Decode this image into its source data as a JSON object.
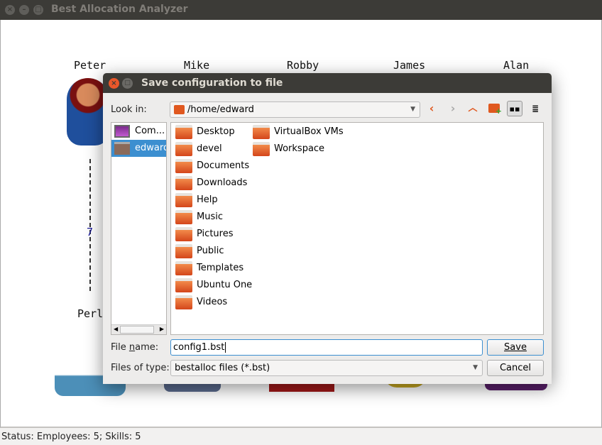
{
  "window": {
    "title": "Best Allocation Analyzer"
  },
  "canvas": {
    "employees": [
      "Peter",
      "Mike",
      "Robby",
      "James",
      "Alan"
    ],
    "skills": [
      "Perl"
    ],
    "link_label": "7"
  },
  "status": "Status:  Employees: 5;  Skills: 5",
  "dialog": {
    "title": "Save configuration to file",
    "look_in_label": "Look in:",
    "look_in_value": "/home/edward",
    "sidebar": [
      {
        "label": "Computer",
        "display": "Com...",
        "icon": "computer-icon"
      },
      {
        "label": "edward",
        "icon": "home-folder-icon",
        "selected": true
      }
    ],
    "files_col1": [
      "Desktop",
      "devel",
      "Documents",
      "Downloads",
      "Help",
      "Music",
      "Pictures",
      "Public",
      "Templates",
      "Ubuntu One",
      "Videos"
    ],
    "files_col2": [
      "VirtualBox VMs",
      "Workspace"
    ],
    "file_name_label": "File name:",
    "file_name_value": "config1.bst",
    "file_type_label": "Files of type:",
    "file_type_value": "bestalloc files (*.bst)",
    "save_label": "Save",
    "cancel_label": "Cancel"
  },
  "colors": {
    "accent": "#3c8fd0",
    "folder": "#e0581f",
    "titlebar": "#3c3b37"
  }
}
